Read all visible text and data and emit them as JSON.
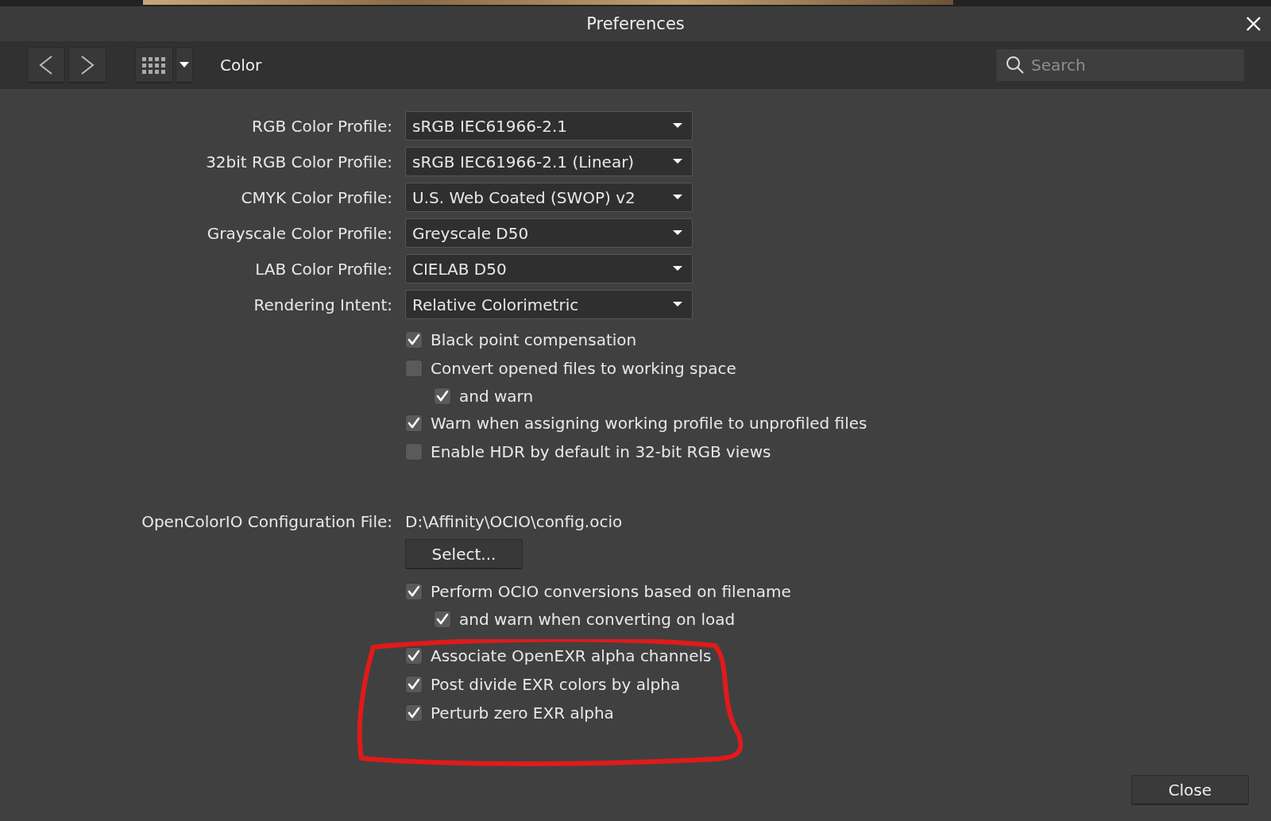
{
  "window": {
    "title": "Preferences"
  },
  "toolbar": {
    "section": "Color",
    "search": {
      "placeholder": "Search"
    }
  },
  "profiles": [
    {
      "label": "RGB Color Profile:",
      "value": "sRGB IEC61966-2.1"
    },
    {
      "label": "32bit RGB Color Profile:",
      "value": "sRGB IEC61966-2.1 (Linear)"
    },
    {
      "label": "CMYK Color Profile:",
      "value": "U.S. Web Coated (SWOP) v2"
    },
    {
      "label": "Grayscale Color Profile:",
      "value": "Greyscale D50"
    },
    {
      "label": "LAB Color Profile:",
      "value": "CIELAB D50"
    },
    {
      "label": "Rendering Intent:",
      "value": "Relative Colorimetric"
    }
  ],
  "color_options": [
    {
      "label": "Black point compensation",
      "checked": true
    },
    {
      "label": "Convert opened files to working space",
      "checked": false,
      "children": [
        {
          "label": "and warn",
          "checked": true
        }
      ]
    },
    {
      "label": "Warn when assigning working profile to unprofiled files",
      "checked": true
    },
    {
      "label": "Enable HDR by default in 32-bit RGB views",
      "checked": false
    }
  ],
  "ocio": {
    "label": "OpenColorIO Configuration File:",
    "path": "D:\\Affinity\\OCIO\\config.ocio",
    "button": "Select...",
    "options": [
      {
        "label": "Perform OCIO conversions based on filename",
        "checked": true,
        "children": [
          {
            "label": "and warn when converting on load",
            "checked": true
          }
        ]
      }
    ]
  },
  "exr_options": [
    {
      "label": "Associate OpenEXR alpha channels",
      "checked": true
    },
    {
      "label": "Post divide EXR colors by alpha",
      "checked": true
    },
    {
      "label": "Perturb zero EXR alpha",
      "checked": true
    }
  ],
  "close_button": "Close"
}
